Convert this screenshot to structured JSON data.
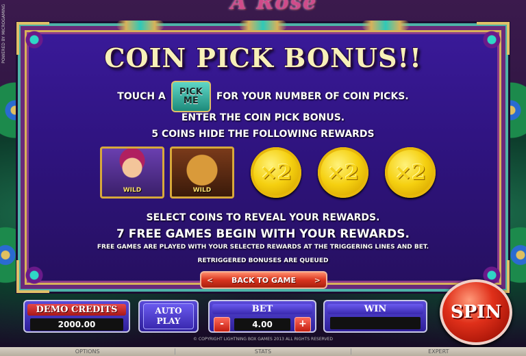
{
  "game": {
    "logo": "A Rose",
    "side_text": "POWERED BY MICROGAMING"
  },
  "bonus_screen": {
    "title": "COIN PICK BONUS!!",
    "touch_prefix": "TOUCH A",
    "pick_me_line1": "PICK",
    "pick_me_line2": "ME",
    "touch_suffix": "FOR YOUR NUMBER OF COIN PICKS.",
    "enter_line": "ENTER THE COIN PICK BONUS.",
    "hide_line": "5 COINS HIDE THE FOLLOWING REWARDS",
    "rewards": {
      "tile_a_badge": "WILD",
      "tile_b_badge": "WILD",
      "coin_labels": [
        "×2",
        "×2",
        "×2"
      ]
    },
    "select_line": "SELECT COINS TO REVEAL YOUR REWARDS.",
    "free_games_line": "7 FREE GAMES BEGIN WITH YOUR REWARDS.",
    "free_games_note": "FREE GAMES ARE PLAYED WITH YOUR SELECTED REWARDS AT THE TRIGGERING LINES AND BET.",
    "retrigger_note": "RETRIGGERED BONUSES ARE QUEUED",
    "back_button": "BACK TO GAME",
    "back_left_arrow": "<",
    "back_right_arrow": ">"
  },
  "controls": {
    "demo_credits_label": "DEMO CREDITS",
    "demo_credits_value": "2000.00",
    "auto_play_line1": "AUTO",
    "auto_play_line2": "PLAY",
    "bet_label": "BET",
    "bet_minus": "-",
    "bet_plus": "+",
    "bet_value": "4.00",
    "win_label": "WIN",
    "win_value": "",
    "spin_label": "SPIN"
  },
  "copyright": "© COPYRIGHT LIGHTNING BOX GAMES 2013 ALL RIGHTS RESERVED",
  "footer": {
    "options": "OPTIONS",
    "stats": "STATS",
    "expert": "EXPERT"
  }
}
